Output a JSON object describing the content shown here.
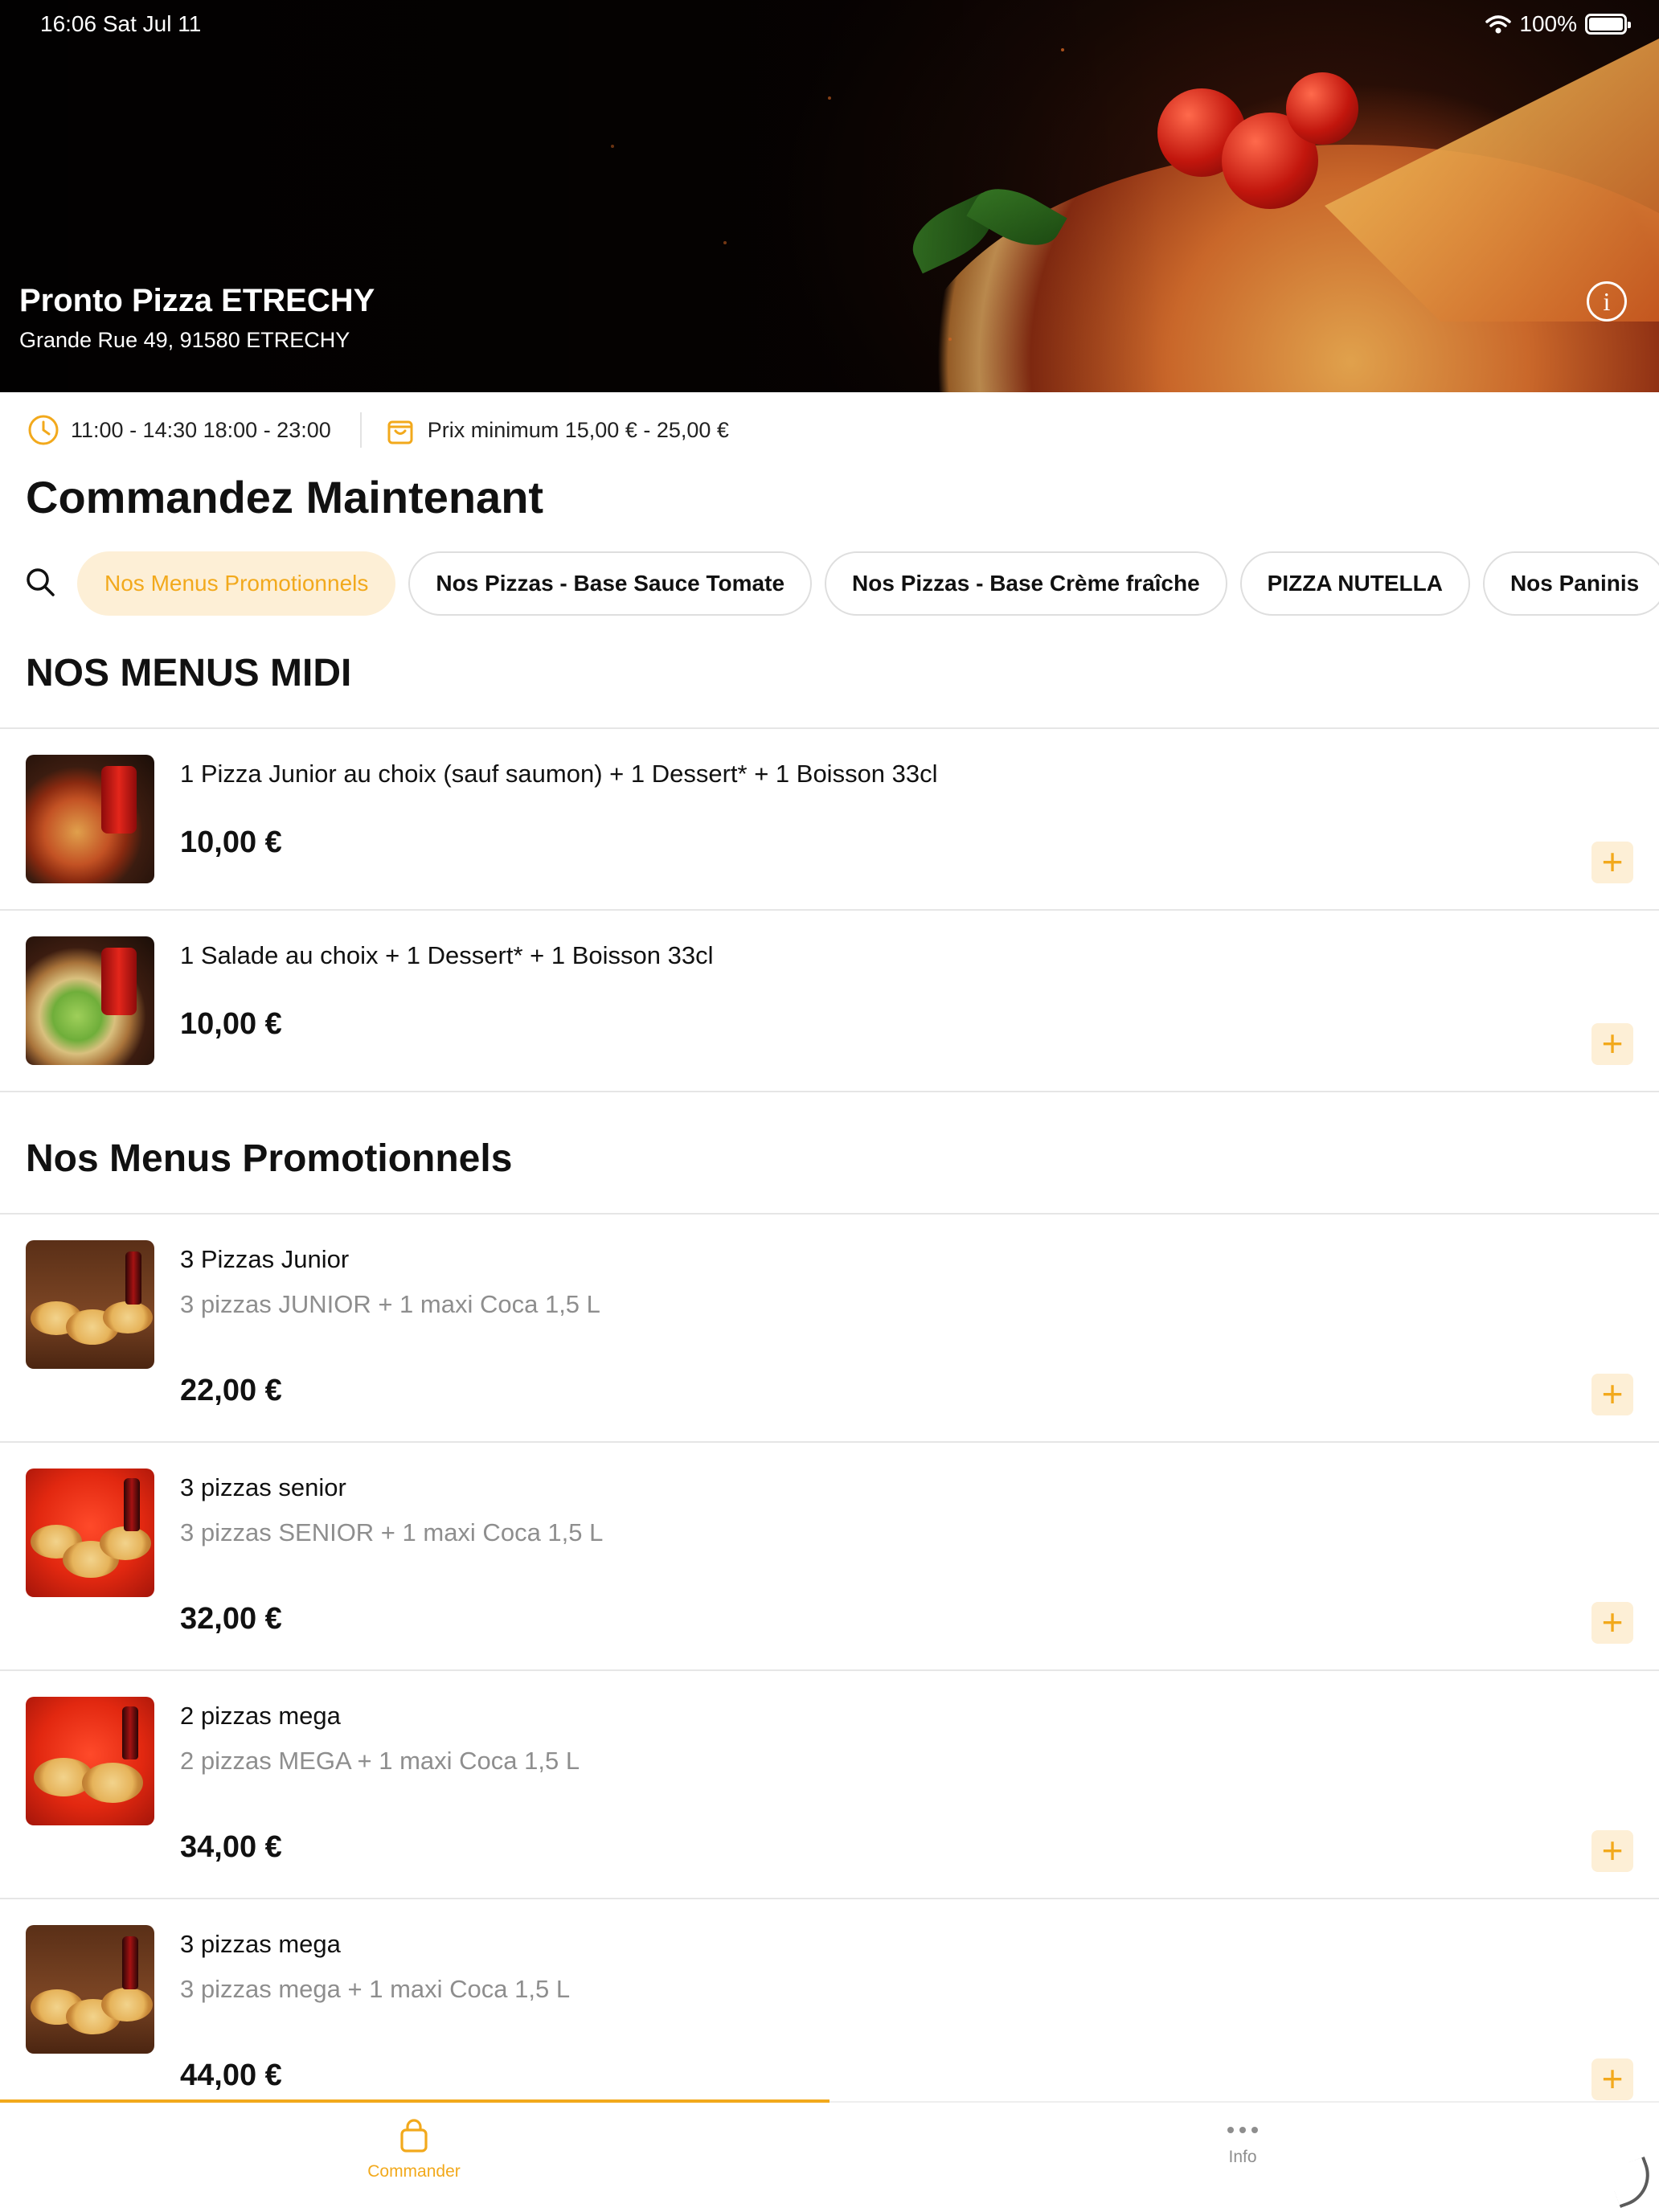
{
  "status_bar": {
    "time": "16:06  Sat Jul 11",
    "battery": "100%"
  },
  "restaurant": {
    "name": "Pronto Pizza ETRECHY",
    "address": "Grande Rue 49, 91580 ETRECHY"
  },
  "info_strip": {
    "hours": "11:00 - 14:30  18:00 - 23:00",
    "min_price": "Prix minimum 15,00 € - 25,00 €"
  },
  "page_title": "Commandez Maintenant",
  "categories": [
    {
      "label": "Nos Menus Promotionnels",
      "active": true
    },
    {
      "label": "Nos Pizzas - Base Sauce Tomate",
      "active": false
    },
    {
      "label": "Nos Pizzas - Base Crème fraîche",
      "active": false
    },
    {
      "label": "PIZZA NUTELLA",
      "active": false
    },
    {
      "label": "Nos Paninis",
      "active": false
    }
  ],
  "sections": [
    {
      "title": "NOS MENUS MIDI",
      "items": [
        {
          "title": "1 Pizza Junior au choix (sauf saumon)  +  1 Dessert*  +  1 Boisson 33cl",
          "price": "10,00 €"
        },
        {
          "title": "1 Salade au choix  +  1 Dessert*  +  1 Boisson 33cl",
          "price": "10,00 €"
        }
      ]
    },
    {
      "title": "Nos Menus Promotionnels",
      "items": [
        {
          "title": "3 Pizzas Junior",
          "desc": "3 pizzas JUNIOR + 1 maxi Coca 1,5 L",
          "price": "22,00 €"
        },
        {
          "title": "3 pizzas senior",
          "desc": "3 pizzas SENIOR + 1 maxi Coca 1,5 L",
          "price": "32,00 €"
        },
        {
          "title": "2 pizzas mega",
          "desc": "2 pizzas MEGA + 1 maxi Coca 1,5 L",
          "price": "34,00 €"
        },
        {
          "title": "3 pizzas mega",
          "desc": "3 pizzas mega  + 1 maxi Coca 1,5 L",
          "price": "44,00 €"
        }
      ]
    }
  ],
  "tab_bar": {
    "commander": "Commander",
    "info": "Info"
  },
  "colors": {
    "accent": "#f2a91c",
    "accent_light": "#fdefd6"
  }
}
